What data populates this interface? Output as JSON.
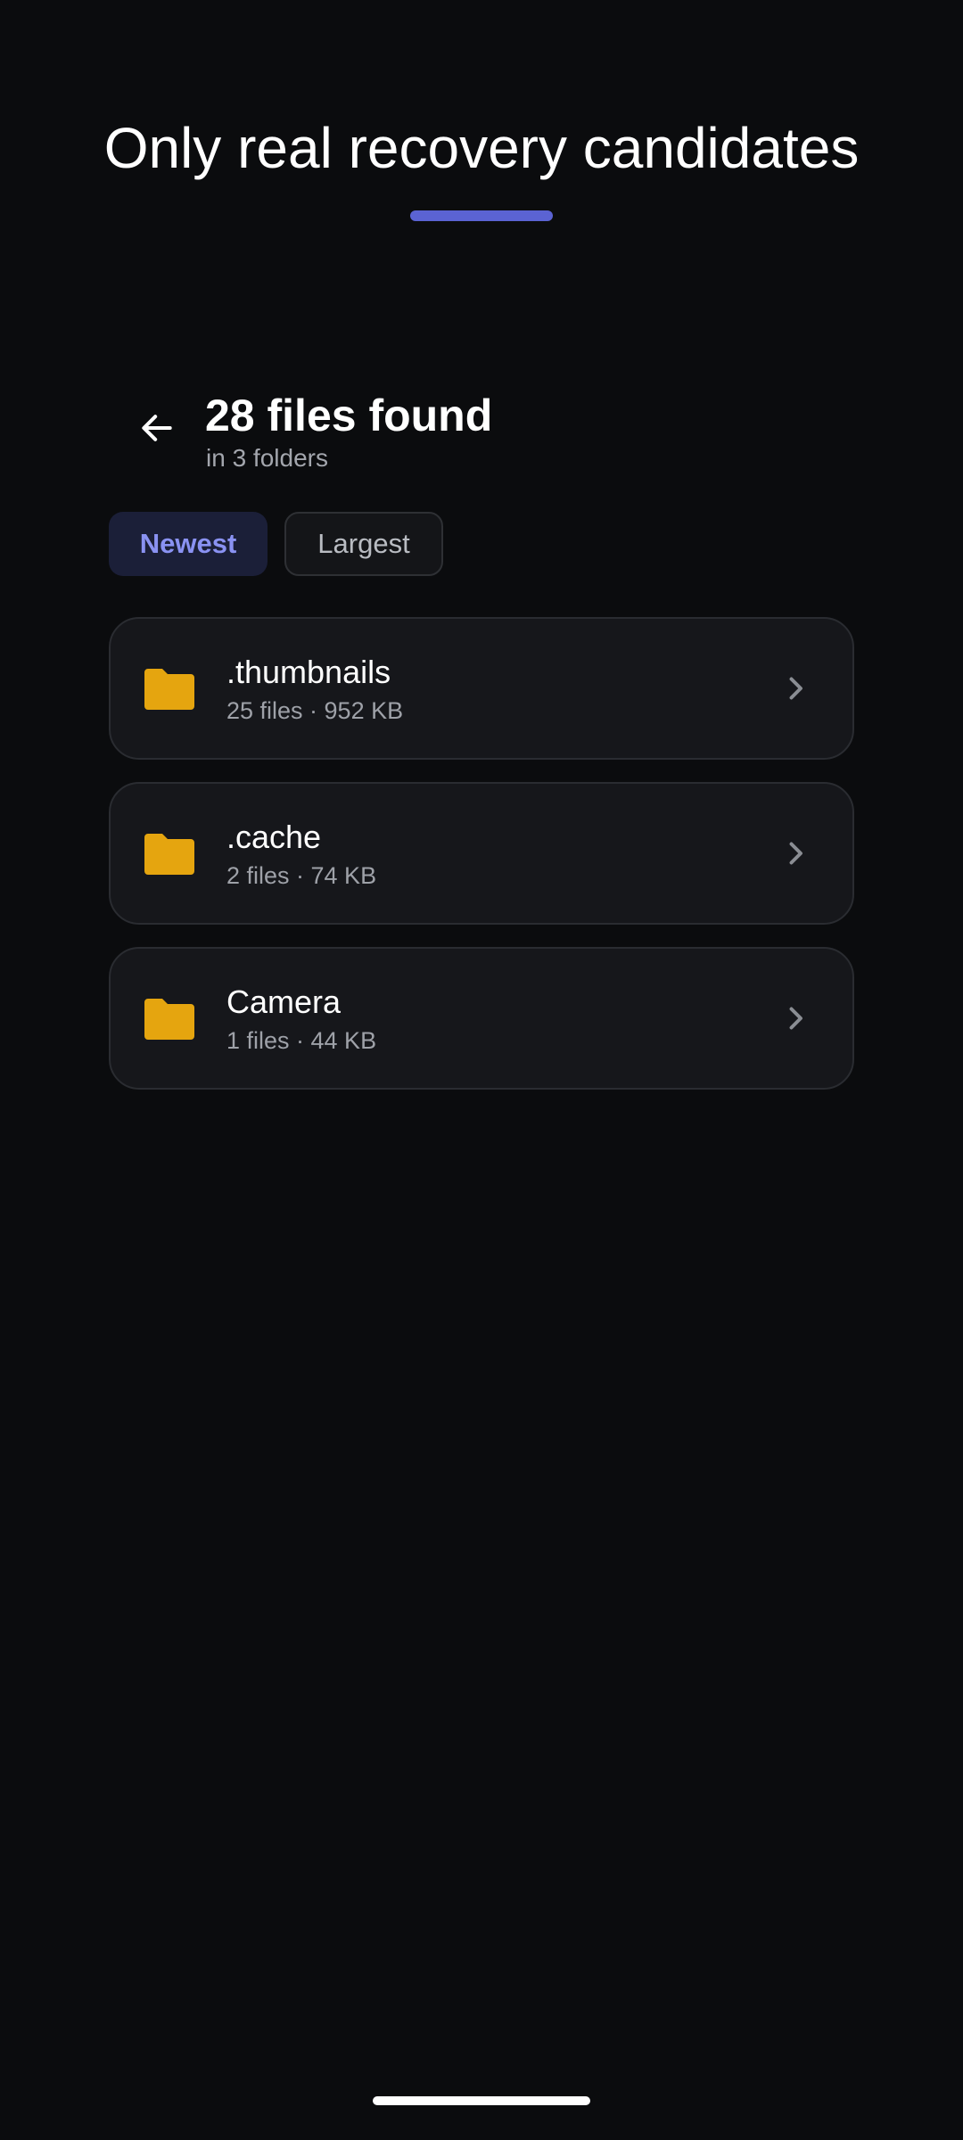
{
  "hero": {
    "title": "Only real recovery candidates"
  },
  "header": {
    "back_icon": "arrow-left-icon",
    "title": "28 files found",
    "subtitle": "in 3 folders"
  },
  "sort_chips": [
    {
      "label": "Newest",
      "selected": true
    },
    {
      "label": "Largest",
      "selected": false
    }
  ],
  "folders": [
    {
      "name": ".thumbnails",
      "meta": "25 files · 952 KB",
      "icon": "folder-icon"
    },
    {
      "name": ".cache",
      "meta": "2 files · 74 KB",
      "icon": "folder-icon"
    },
    {
      "name": "Camera",
      "meta": "1 files · 44 KB",
      "icon": "folder-icon"
    }
  ],
  "colors": {
    "background": "#0b0c0e",
    "accent": "#5b63d3",
    "chip_selected_text": "#8a92f2",
    "folder": "#e5a50f",
    "card": "#16171b"
  }
}
